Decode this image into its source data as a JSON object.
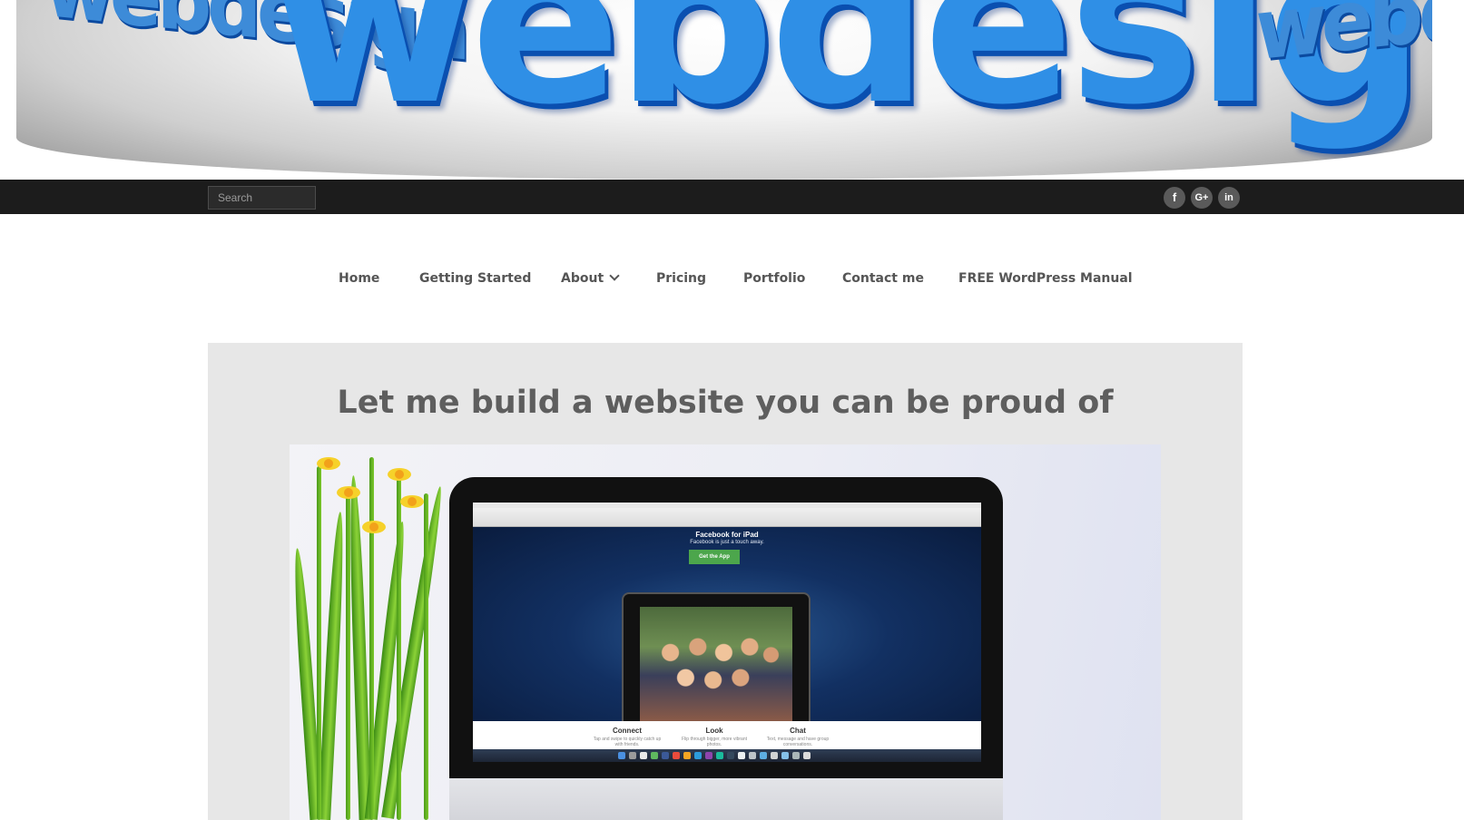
{
  "banner": {
    "main_word": "webdesign",
    "side_word": "webdesign"
  },
  "topbar": {
    "search_placeholder": "Search",
    "social_links": [
      {
        "name": "facebook",
        "glyph": "f"
      },
      {
        "name": "google-plus",
        "glyph": "G+"
      },
      {
        "name": "linkedin",
        "glyph": "in"
      }
    ]
  },
  "nav": {
    "items": [
      {
        "label": "Home"
      },
      {
        "label": "Getting Started"
      },
      {
        "label": "About",
        "has_dropdown": true
      },
      {
        "label": "Pricing"
      },
      {
        "label": "Portfolio"
      },
      {
        "label": "Contact me"
      },
      {
        "label": "FREE WordPress Manual"
      }
    ]
  },
  "main": {
    "title": "Let me build a website you can be proud of"
  },
  "hero": {
    "screen_title": "Facebook for iPad",
    "screen_subtitle": "Facebook is just a touch away.",
    "screen_button": "Get the App",
    "features": [
      {
        "title": "Connect",
        "text": "Tap and swipe to quickly catch up with friends."
      },
      {
        "title": "Look",
        "text": "Flip through bigger, more vibrant photos."
      },
      {
        "title": "Chat",
        "text": "Text, message and have group conversations."
      }
    ]
  },
  "colors": {
    "topbar_bg": "#1c1c1c",
    "nav_text": "#555555",
    "content_bg": "#e7e7e7",
    "title_text": "#5e5e5e",
    "social_bg": "#5a5a5a"
  }
}
